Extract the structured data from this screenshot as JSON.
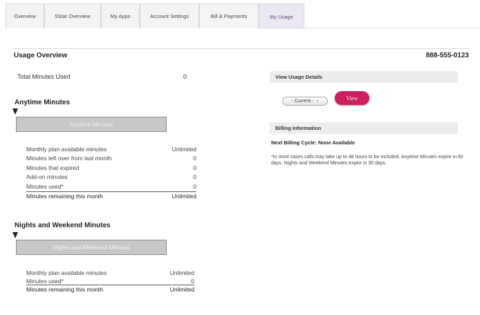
{
  "tabs": [
    {
      "label": "Overview",
      "active": false
    },
    {
      "label": "5Star Overview",
      "active": false
    },
    {
      "label": "My Apps",
      "active": false
    },
    {
      "label": "Account Settings",
      "active": false
    },
    {
      "label": "Bill & Payments",
      "active": false
    },
    {
      "label": "My Usage",
      "active": true
    }
  ],
  "usage_overview": {
    "title": "Usage Overview",
    "phone": "888-555-0123",
    "total_label": "Total Minutes Used",
    "total_value": "0"
  },
  "anytime": {
    "title": "Anytime Minutes",
    "bar_label": "Anytime Minutes",
    "rows": [
      {
        "label": "Monthly plan available minutes",
        "value": "Unlimited"
      },
      {
        "label": "Minutes left over from last month",
        "value": "0"
      },
      {
        "label": "Minutes that expired",
        "value": "0"
      },
      {
        "label": "Add-on minutes",
        "value": "0"
      },
      {
        "label": "Minutes used*",
        "value": "0"
      }
    ],
    "total": {
      "label": "Minutes remaining this month",
      "value": "Unlimited"
    }
  },
  "nights": {
    "title": "Nights and Weekend Minutes",
    "bar_label": "Nights and Weekend Minutes",
    "rows": [
      {
        "label": "Monthly plan available minutes",
        "value": "Unlimited"
      },
      {
        "label": "Minutes used*",
        "value": "0"
      }
    ],
    "total": {
      "label": "Minutes remaining this month",
      "value": "Unlimited"
    }
  },
  "usage_details": {
    "title": "View Usage Details",
    "select_value": "- Current -",
    "view_label": "View"
  },
  "billing": {
    "title": "Billing Information",
    "next_cycle": "Next Billing Cycle: None Available",
    "note": "*In most cases calls may take up to 48 hours to be included. Anytime Minutes expire in 60 days. Nights and Weekend Minutes expire in 30 days."
  },
  "colors": {
    "accent": "#cc1f5f",
    "active_tab": "#ece8f3"
  }
}
